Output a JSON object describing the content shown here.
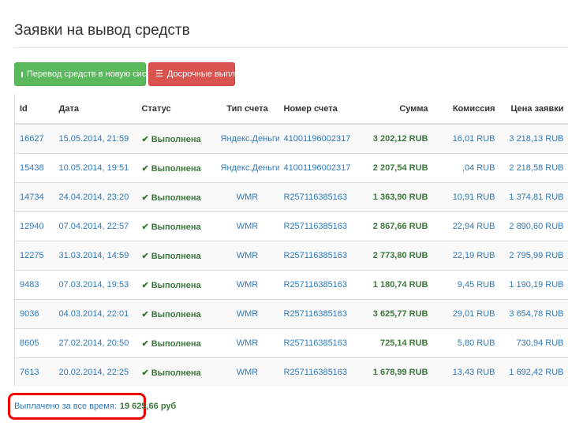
{
  "page": {
    "title": "Заявки на вывод средств"
  },
  "buttons": {
    "transfer": {
      "label": "Перевод средств в новую систему",
      "icon": "monitor-icon"
    },
    "early_payout": {
      "label": "Досрочные выплаты",
      "icon": "list-icon"
    }
  },
  "table": {
    "headers": {
      "id": "Id",
      "date": "Дата",
      "status": "Статус",
      "type": "Тип счета",
      "account": "Номер счета",
      "sum": "Сумма",
      "fee": "Комиссия",
      "price": "Цена заявки"
    },
    "rows": [
      {
        "id": "16627",
        "date": "15.05.2014, 21:59",
        "status": "Выполнена",
        "type": "Яндекс.Деньги",
        "account": "41001196002317",
        "sum": "3 202,12 RUB",
        "fee": "16,01 RUB",
        "price": "3 218,13 RUB"
      },
      {
        "id": "15438",
        "date": "10.05.2014, 19:51",
        "status": "Выполнена",
        "type": "Яндекс.Деньги",
        "account": "41001196002317",
        "sum": "2 207,54 RUB",
        "fee": ",04 RUB",
        "price": "2 218,58 RUB"
      },
      {
        "id": "14734",
        "date": "24.04.2014, 23:20",
        "status": "Выполнена",
        "type": "WMR",
        "account": "R257116385163",
        "sum": "1 363,90 RUB",
        "fee": "10,91 RUB",
        "price": "1 374,81 RUB"
      },
      {
        "id": "12940",
        "date": "07.04.2014, 22:57",
        "status": "Выполнена",
        "type": "WMR",
        "account": "R257116385163",
        "sum": "2 867,66 RUB",
        "fee": "22,94 RUB",
        "price": "2 890,60 RUB"
      },
      {
        "id": "12275",
        "date": "31.03.2014, 14:59",
        "status": "Выполнена",
        "type": "WMR",
        "account": "R257116385163",
        "sum": "2 773,80 RUB",
        "fee": "22,19 RUB",
        "price": "2 795,99 RUB"
      },
      {
        "id": "9483",
        "date": "07.03.2014, 19:53",
        "status": "Выполнена",
        "type": "WMR",
        "account": "R257116385163",
        "sum": "1 180,74 RUB",
        "fee": "9,45 RUB",
        "price": "1 190,19 RUB"
      },
      {
        "id": "9036",
        "date": "04.03.2014, 22:01",
        "status": "Выполнена",
        "type": "WMR",
        "account": "R257116385163",
        "sum": "3 625,77 RUB",
        "fee": "29,01 RUB",
        "price": "3 654,78 RUB"
      },
      {
        "id": "8605",
        "date": "27.02.2014, 20:50",
        "status": "Выполнена",
        "type": "WMR",
        "account": "R257116385163",
        "sum": "725,14 RUB",
        "fee": "5,80 RUB",
        "price": "730,94 RUB"
      },
      {
        "id": "7613",
        "date": "20.02.2014, 22:25",
        "status": "Выполнена",
        "type": "WMR",
        "account": "R257116385163",
        "sum": "1 678,99 RUB",
        "fee": "13,43 RUB",
        "price": "1 692,42 RUB"
      }
    ]
  },
  "total": {
    "label": "Выплачено за все время:",
    "value": "19 625,66 руб"
  },
  "colors": {
    "green_button": "#5cb85c",
    "red_button": "#d9534f",
    "link_blue": "#337ab7",
    "success_green": "#3c763d",
    "highlight_red": "#ee0000"
  }
}
